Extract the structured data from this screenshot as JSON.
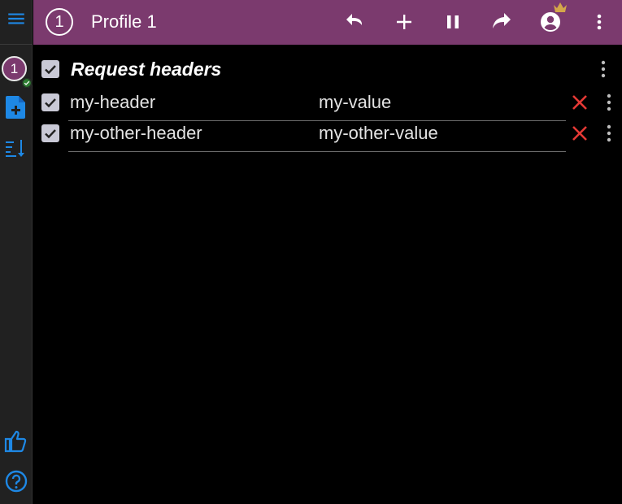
{
  "sidebar": {
    "menu_icon": "hamburger-menu-icon",
    "profile_badge": "1",
    "icons": [
      "add-file-icon",
      "sort-icon",
      "thumbs-up-icon",
      "help-icon"
    ]
  },
  "topbar": {
    "profile_number": "1",
    "title": "Profile 1",
    "actions": [
      "undo-icon",
      "add-icon",
      "pause-icon",
      "share-icon",
      "account-icon",
      "more-vert-icon"
    ]
  },
  "group": {
    "title": "Request headers",
    "checked": true
  },
  "headers": [
    {
      "name": "my-header",
      "value": "my-value",
      "checked": true
    },
    {
      "name": "my-other-header",
      "value": "my-other-value",
      "checked": true
    }
  ],
  "colors": {
    "topbar": "#7b3a6e",
    "sidebar": "#212121",
    "background": "#000000",
    "accent_blue": "#1e88e5",
    "delete_red": "#e53935",
    "crown": "#d4a64a"
  }
}
